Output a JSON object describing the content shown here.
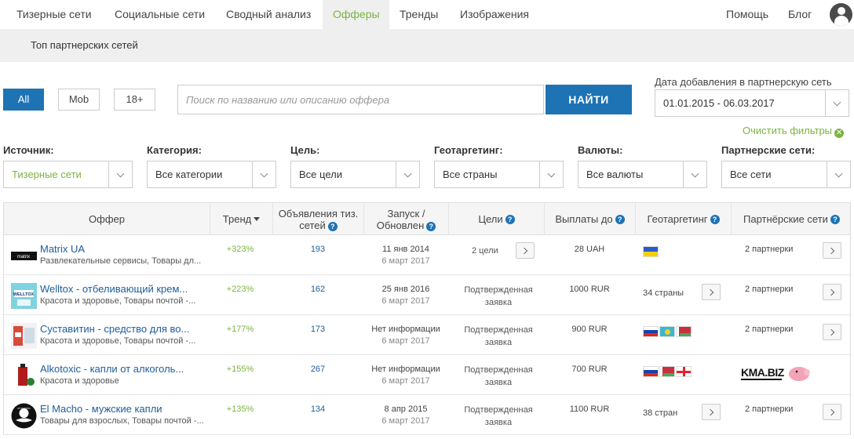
{
  "nav": {
    "items": [
      "Тизерные сети",
      "Социальные сети",
      "Сводный анализ",
      "Офферы",
      "Тренды",
      "Изображения"
    ],
    "active": "Офферы",
    "help": "Помощь",
    "blog": "Блог"
  },
  "subnav": {
    "item": "Топ партнерских сетей"
  },
  "segments": {
    "all": "All",
    "mob": "Mob",
    "adult": "18+",
    "active": "All"
  },
  "search": {
    "placeholder": "Поиск по названию или описанию оффера",
    "button": "НАЙТИ"
  },
  "date_filter": {
    "label": "Дата добавления в партнерскую сеть",
    "value": "01.01.2015 - 06.03.2017"
  },
  "clear_filters": "Очистить фильтры",
  "filters": [
    {
      "label": "Источник:",
      "value": "Тизерные сети"
    },
    {
      "label": "Категория:",
      "value": "Все категории"
    },
    {
      "label": "Цель:",
      "value": "Все цели"
    },
    {
      "label": "Геотаргетинг:",
      "value": "Все страны"
    },
    {
      "label": "Валюты:",
      "value": "Все валюты"
    },
    {
      "label": "Партнерские сети:",
      "value": "Все сети"
    }
  ],
  "table": {
    "headers": {
      "offer": "Оффер",
      "trend": "Тренд",
      "ads_1": "Объявления тиз.",
      "ads_2": "сетей",
      "launch_1": "Запуск /",
      "launch_2": "Обновлен",
      "goals": "Цели",
      "payouts": "Выплаты до",
      "geo": "Геотаргетинг",
      "networks": "Партнёрские сети"
    },
    "rows": [
      {
        "name": "Matrix UA",
        "category": "Развлекательные сервисы, Товары дл...",
        "trend": "+323%",
        "ads": "193",
        "launch": "11 янв 2014",
        "updated": "6 март 2017",
        "goals": "2 цели",
        "payout": "28 UAH",
        "geo": "",
        "networks": "2 партнерки"
      },
      {
        "name": "Welltox - отбеливающий крем...",
        "category": "Красота и здоровье, Товары почтой -...",
        "trend": "+223%",
        "ads": "162",
        "launch": "25 янв 2016",
        "updated": "6 март 2017",
        "goals": "Подтвержденная заявка",
        "payout": "1000 RUR",
        "geo": "34 страны",
        "networks": "2 партнерки"
      },
      {
        "name": "Суставитин - средство для во...",
        "category": "Красота и здоровье, Товары почтой -...",
        "trend": "+177%",
        "ads": "173",
        "launch": "Нет информации",
        "updated": "6 март 2017",
        "goals": "Подтвержденная заявка",
        "payout": "900 RUR",
        "geo": "",
        "networks": "2 партнерки"
      },
      {
        "name": "Alkotoxic - капли от алкоголь...",
        "category": "Красота и здоровье",
        "trend": "+155%",
        "ads": "267",
        "launch": "Нет информации",
        "updated": "6 март 2017",
        "goals": "Подтвержденная заявка",
        "payout": "700 RUR",
        "geo": "",
        "networks": "KMA.BIZ"
      },
      {
        "name": "El Macho - мужские капли",
        "category": "Товары для взрослых, Товары почтой -...",
        "trend": "+135%",
        "ads": "134",
        "launch": "8 апр 2015",
        "updated": "6 март 2017",
        "goals": "Подтвержденная заявка",
        "payout": "1100 RUR",
        "geo": "38 стран",
        "networks": "2 партнерки"
      }
    ]
  },
  "colors": {
    "accent_blue": "#1e73b5",
    "accent_green": "#7cb342",
    "link_blue": "#1e5d9b"
  }
}
